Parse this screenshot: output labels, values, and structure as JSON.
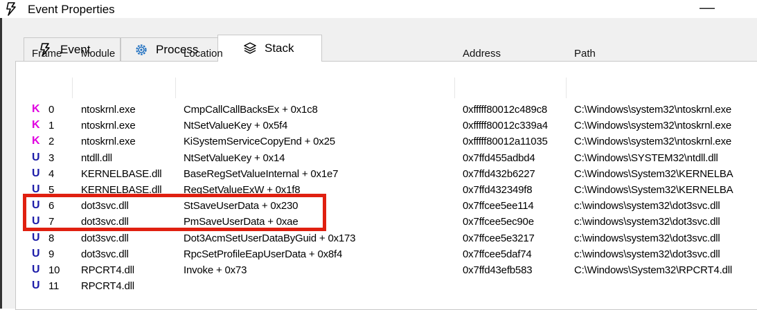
{
  "window": {
    "title": "Event Properties",
    "minimize_glyph": "—",
    "title_icon": "lightning-icon"
  },
  "tabs": [
    {
      "label": "Event",
      "icon": "lightning-icon",
      "active": false
    },
    {
      "label": "Process",
      "icon": "gear-icon",
      "active": false
    },
    {
      "label": "Stack",
      "icon": "stack-icon",
      "active": true
    }
  ],
  "columns": {
    "frame": "Frame",
    "module": "Module",
    "location": "Location",
    "address": "Address",
    "path": "Path"
  },
  "colors": {
    "kernel_frame": "#e000e0",
    "user_frame": "#1a1aa8",
    "highlight_border": "#e02010"
  },
  "rows": [
    {
      "kind": "K",
      "frame": "0",
      "module": "ntoskrnl.exe",
      "location": "CmpCallCallBacksEx + 0x1c8",
      "address": "0xfffff80012c489c8",
      "path": "C:\\Windows\\system32\\ntoskrnl.exe"
    },
    {
      "kind": "K",
      "frame": "1",
      "module": "ntoskrnl.exe",
      "location": "NtSetValueKey + 0x5f4",
      "address": "0xfffff80012c339a4",
      "path": "C:\\Windows\\system32\\ntoskrnl.exe"
    },
    {
      "kind": "K",
      "frame": "2",
      "module": "ntoskrnl.exe",
      "location": "KiSystemServiceCopyEnd + 0x25",
      "address": "0xfffff80012a11035",
      "path": "C:\\Windows\\system32\\ntoskrnl.exe"
    },
    {
      "kind": "U",
      "frame": "3",
      "module": "ntdll.dll",
      "location": "NtSetValueKey + 0x14",
      "address": "0x7ffd455adbd4",
      "path": "C:\\Windows\\SYSTEM32\\ntdll.dll"
    },
    {
      "kind": "U",
      "frame": "4",
      "module": "KERNELBASE.dll",
      "location": "BaseRegSetValueInternal + 0x1e7",
      "address": "0x7ffd432b6227",
      "path": "C:\\Windows\\System32\\KERNELBA"
    },
    {
      "kind": "U",
      "frame": "5",
      "module": "KERNELBASE.dll",
      "location": "RegSetValueExW + 0x1f8",
      "address": "0x7ffd432349f8",
      "path": "C:\\Windows\\System32\\KERNELBA"
    },
    {
      "kind": "U",
      "frame": "6",
      "module": "dot3svc.dll",
      "location": "StSaveUserData + 0x230",
      "address": "0x7ffcee5ee114",
      "path": "c:\\windows\\system32\\dot3svc.dll"
    },
    {
      "kind": "U",
      "frame": "7",
      "module": "dot3svc.dll",
      "location": "PmSaveUserData + 0xae",
      "address": "0x7ffcee5ec90e",
      "path": "c:\\windows\\system32\\dot3svc.dll"
    },
    {
      "kind": "U",
      "frame": "8",
      "module": "dot3svc.dll",
      "location": "Dot3AcmSetUserDataByGuid + 0x173",
      "address": "0x7ffcee5e3217",
      "path": "c:\\windows\\system32\\dot3svc.dll"
    },
    {
      "kind": "U",
      "frame": "9",
      "module": "dot3svc.dll",
      "location": "RpcSetProfileEapUserData + 0x8f4",
      "address": "0x7ffcee5daf74",
      "path": "c:\\windows\\system32\\dot3svc.dll"
    },
    {
      "kind": "U",
      "frame": "10",
      "module": "RPCRT4.dll",
      "location": "Invoke + 0x73",
      "address": "0x7ffd43efb583",
      "path": "C:\\Windows\\System32\\RPCRT4.dll"
    },
    {
      "kind": "U",
      "frame": "11",
      "module": "RPCRT4.dll",
      "location": "",
      "address": "",
      "path": ""
    }
  ]
}
